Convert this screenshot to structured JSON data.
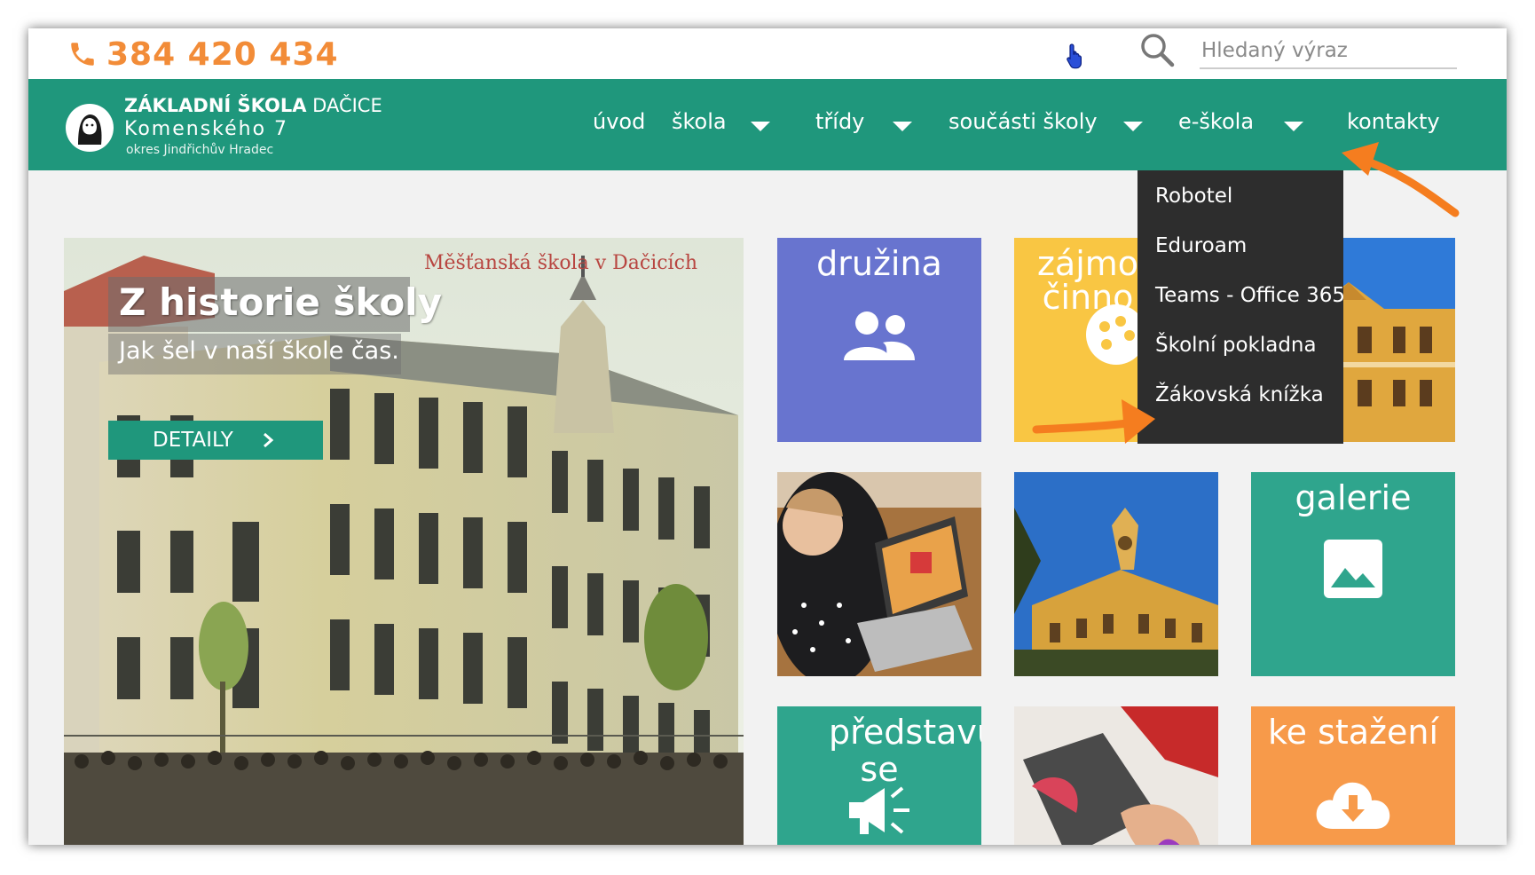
{
  "header": {
    "phone": "384 420 434",
    "search_placeholder": "Hledaný výraz"
  },
  "logo": {
    "name_bold": "ZÁKLADNÍ ŠKOLA",
    "name_light": "DAČICE",
    "street": "Komenského 7",
    "district": "okres Jindřichův Hradec"
  },
  "nav": {
    "uvod": "úvod",
    "skola": "škola",
    "tridy": "třídy",
    "soucasti": "součásti školy",
    "eskola": "e-škola",
    "kontakty": "kontakty"
  },
  "dropdown": {
    "items": [
      "Robotel",
      "Eduroam",
      "Teams - Office 365",
      "Školní pokladna",
      "Žákovská knížka"
    ]
  },
  "hero": {
    "title": "Z historie školy",
    "subtitle": "Jak šel v naší škole čas.",
    "button": "DETAILY",
    "caption": "Měšťanská škola v Dačicích"
  },
  "tiles": {
    "druzina": "družina",
    "zajmova_line1": "zájmo",
    "zajmova_line2": "činno",
    "galerie": "galerie",
    "predstavujeme_line1": "představujem",
    "predstavujeme_line2": "se",
    "ke_stazeni": "ke stažení"
  },
  "colors": {
    "accent": "#f28c38",
    "nav": "#1f977c",
    "dropdown": "#2d2d2d",
    "tile_blue": "#6874cf",
    "tile_yellow": "#f9c643",
    "tile_teal": "#2fa58d",
    "tile_orange": "#f79a4a",
    "arrow": "#f57d1f"
  }
}
